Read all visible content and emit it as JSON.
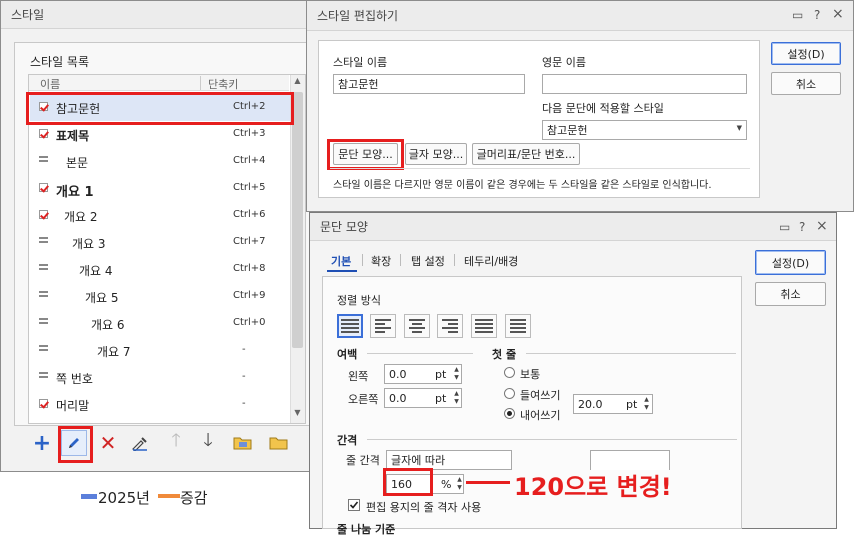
{
  "style_dialog": {
    "title": "스타일",
    "list_title": "스타일 목록",
    "col_name": "이름",
    "col_shortcut": "단축키",
    "items": [
      {
        "name": "참고문헌",
        "shortcut": "Ctrl+2",
        "icon": "char-style-icon"
      },
      {
        "name": "표제목",
        "shortcut": "Ctrl+3",
        "icon": "char-style-icon"
      },
      {
        "name": "본문",
        "shortcut": "Ctrl+4",
        "icon": "para-style-icon"
      },
      {
        "name": "개요 1",
        "shortcut": "Ctrl+5",
        "icon": "char-style-icon"
      },
      {
        "name": "개요 2",
        "shortcut": "Ctrl+6",
        "icon": "char-style-icon"
      },
      {
        "name": "개요 3",
        "shortcut": "Ctrl+7",
        "icon": "para-style-icon"
      },
      {
        "name": "개요 4",
        "shortcut": "Ctrl+8",
        "icon": "para-style-icon"
      },
      {
        "name": "개요 5",
        "shortcut": "Ctrl+9",
        "icon": "para-style-icon"
      },
      {
        "name": "개요 6",
        "shortcut": "Ctrl+0",
        "icon": "para-style-icon"
      },
      {
        "name": "개요 7",
        "shortcut": "-",
        "icon": "para-style-icon"
      },
      {
        "name": "쪽 번호",
        "shortcut": "-",
        "icon": "para-style-icon"
      },
      {
        "name": "머리말",
        "shortcut": "-",
        "icon": "char-style-icon"
      }
    ]
  },
  "edit_dialog": {
    "title": "스타일 편집하기",
    "style_name_label": "스타일 이름",
    "style_name_value": "참고문헌",
    "english_name_label": "영문 이름",
    "english_name_value": "",
    "next_style_label": "다음 문단에 적용할 스타일",
    "next_style_value": "참고문헌",
    "para_shape_btn": "문단 모양...",
    "char_shape_btn": "글자 모양...",
    "bullet_btn": "글머리표/문단 번호...",
    "note": "스타일 이름은 다르지만 영문 이름이 같은 경우에는 두 스타일을 같은 스타일로 인식합니다.",
    "ok": "설정(D)",
    "cancel": "취소",
    "title_buttons": {
      "help": "?",
      "close": "×"
    }
  },
  "para_dialog": {
    "title": "문단 모양",
    "tabs": [
      "기본",
      "확장",
      "탭 설정",
      "테두리/배경"
    ],
    "ok": "설정(D)",
    "cancel": "취소",
    "align_label": "정렬 방식",
    "margin_section": "여백",
    "left_label": "왼쪽",
    "left_value": "0.0",
    "right_label": "오른쪽",
    "right_value": "0.0",
    "unit_pt": "pt",
    "first_line_section": "첫 줄",
    "first_line_options": [
      "보통",
      "들여쓰기",
      "내어쓰기"
    ],
    "first_line_selected": "내어쓰기",
    "indent_value": "20.0",
    "spacing_section": "간격",
    "line_spacing_label": "줄 간격",
    "line_spacing_type": "글자에 따라",
    "line_spacing_value": "160",
    "percent": "%",
    "grid_checkbox": "편집 용지의 줄 격자 사용",
    "partial_next_label": "줄 나눔 기준"
  },
  "annotation": "120으로 변경!",
  "bg_chart_legend": {
    "series": [
      "2025년",
      "증감"
    ],
    "colors": [
      "#5b7fdb",
      "#f08a3a"
    ]
  },
  "colors": {
    "highlight_red": "#e61e1e",
    "selection_blue": "#dde6f6",
    "annotation_red": "#e61e1e"
  }
}
